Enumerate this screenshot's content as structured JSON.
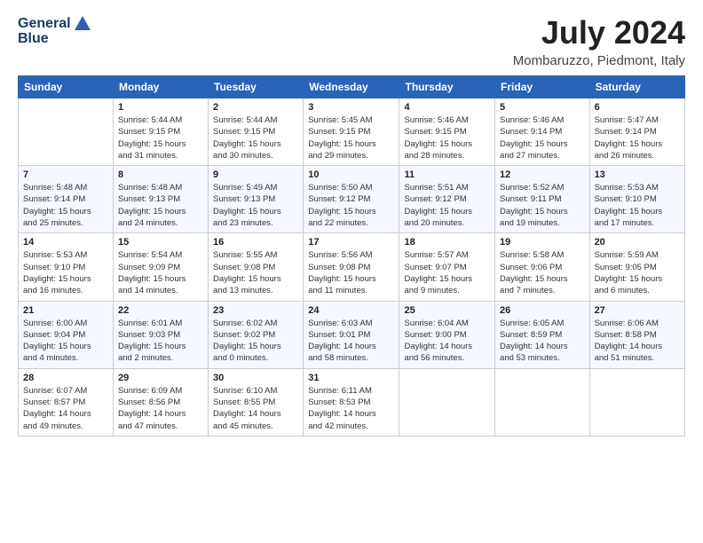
{
  "logo": {
    "line1": "General",
    "line2": "Blue"
  },
  "title": "July 2024",
  "location": "Mombaruzzo, Piedmont, Italy",
  "days_of_week": [
    "Sunday",
    "Monday",
    "Tuesday",
    "Wednesday",
    "Thursday",
    "Friday",
    "Saturday"
  ],
  "weeks": [
    [
      {
        "num": "",
        "info": ""
      },
      {
        "num": "1",
        "info": "Sunrise: 5:44 AM\nSunset: 9:15 PM\nDaylight: 15 hours\nand 31 minutes."
      },
      {
        "num": "2",
        "info": "Sunrise: 5:44 AM\nSunset: 9:15 PM\nDaylight: 15 hours\nand 30 minutes."
      },
      {
        "num": "3",
        "info": "Sunrise: 5:45 AM\nSunset: 9:15 PM\nDaylight: 15 hours\nand 29 minutes."
      },
      {
        "num": "4",
        "info": "Sunrise: 5:46 AM\nSunset: 9:15 PM\nDaylight: 15 hours\nand 28 minutes."
      },
      {
        "num": "5",
        "info": "Sunrise: 5:46 AM\nSunset: 9:14 PM\nDaylight: 15 hours\nand 27 minutes."
      },
      {
        "num": "6",
        "info": "Sunrise: 5:47 AM\nSunset: 9:14 PM\nDaylight: 15 hours\nand 26 minutes."
      }
    ],
    [
      {
        "num": "7",
        "info": "Sunrise: 5:48 AM\nSunset: 9:14 PM\nDaylight: 15 hours\nand 25 minutes."
      },
      {
        "num": "8",
        "info": "Sunrise: 5:48 AM\nSunset: 9:13 PM\nDaylight: 15 hours\nand 24 minutes."
      },
      {
        "num": "9",
        "info": "Sunrise: 5:49 AM\nSunset: 9:13 PM\nDaylight: 15 hours\nand 23 minutes."
      },
      {
        "num": "10",
        "info": "Sunrise: 5:50 AM\nSunset: 9:12 PM\nDaylight: 15 hours\nand 22 minutes."
      },
      {
        "num": "11",
        "info": "Sunrise: 5:51 AM\nSunset: 9:12 PM\nDaylight: 15 hours\nand 20 minutes."
      },
      {
        "num": "12",
        "info": "Sunrise: 5:52 AM\nSunset: 9:11 PM\nDaylight: 15 hours\nand 19 minutes."
      },
      {
        "num": "13",
        "info": "Sunrise: 5:53 AM\nSunset: 9:10 PM\nDaylight: 15 hours\nand 17 minutes."
      }
    ],
    [
      {
        "num": "14",
        "info": "Sunrise: 5:53 AM\nSunset: 9:10 PM\nDaylight: 15 hours\nand 16 minutes."
      },
      {
        "num": "15",
        "info": "Sunrise: 5:54 AM\nSunset: 9:09 PM\nDaylight: 15 hours\nand 14 minutes."
      },
      {
        "num": "16",
        "info": "Sunrise: 5:55 AM\nSunset: 9:08 PM\nDaylight: 15 hours\nand 13 minutes."
      },
      {
        "num": "17",
        "info": "Sunrise: 5:56 AM\nSunset: 9:08 PM\nDaylight: 15 hours\nand 11 minutes."
      },
      {
        "num": "18",
        "info": "Sunrise: 5:57 AM\nSunset: 9:07 PM\nDaylight: 15 hours\nand 9 minutes."
      },
      {
        "num": "19",
        "info": "Sunrise: 5:58 AM\nSunset: 9:06 PM\nDaylight: 15 hours\nand 7 minutes."
      },
      {
        "num": "20",
        "info": "Sunrise: 5:59 AM\nSunset: 9:05 PM\nDaylight: 15 hours\nand 6 minutes."
      }
    ],
    [
      {
        "num": "21",
        "info": "Sunrise: 6:00 AM\nSunset: 9:04 PM\nDaylight: 15 hours\nand 4 minutes."
      },
      {
        "num": "22",
        "info": "Sunrise: 6:01 AM\nSunset: 9:03 PM\nDaylight: 15 hours\nand 2 minutes."
      },
      {
        "num": "23",
        "info": "Sunrise: 6:02 AM\nSunset: 9:02 PM\nDaylight: 15 hours\nand 0 minutes."
      },
      {
        "num": "24",
        "info": "Sunrise: 6:03 AM\nSunset: 9:01 PM\nDaylight: 14 hours\nand 58 minutes."
      },
      {
        "num": "25",
        "info": "Sunrise: 6:04 AM\nSunset: 9:00 PM\nDaylight: 14 hours\nand 56 minutes."
      },
      {
        "num": "26",
        "info": "Sunrise: 6:05 AM\nSunset: 8:59 PM\nDaylight: 14 hours\nand 53 minutes."
      },
      {
        "num": "27",
        "info": "Sunrise: 6:06 AM\nSunset: 8:58 PM\nDaylight: 14 hours\nand 51 minutes."
      }
    ],
    [
      {
        "num": "28",
        "info": "Sunrise: 6:07 AM\nSunset: 8:57 PM\nDaylight: 14 hours\nand 49 minutes."
      },
      {
        "num": "29",
        "info": "Sunrise: 6:09 AM\nSunset: 8:56 PM\nDaylight: 14 hours\nand 47 minutes."
      },
      {
        "num": "30",
        "info": "Sunrise: 6:10 AM\nSunset: 8:55 PM\nDaylight: 14 hours\nand 45 minutes."
      },
      {
        "num": "31",
        "info": "Sunrise: 6:11 AM\nSunset: 8:53 PM\nDaylight: 14 hours\nand 42 minutes."
      },
      {
        "num": "",
        "info": ""
      },
      {
        "num": "",
        "info": ""
      },
      {
        "num": "",
        "info": ""
      }
    ]
  ]
}
